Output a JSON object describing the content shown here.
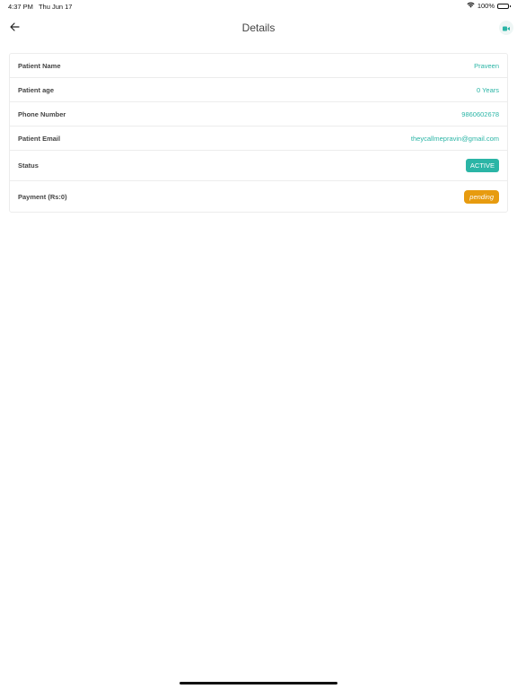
{
  "status_bar": {
    "time": "4:37 PM",
    "date": "Thu Jun 17",
    "battery": "100%",
    "battery_level": 1.0
  },
  "header": {
    "title": "Details",
    "back_icon": "arrow-left-icon",
    "video_icon": "video-camera-icon"
  },
  "details": {
    "patient_name": {
      "label": "Patient Name",
      "value": "Praveen"
    },
    "patient_age": {
      "label": "Patient age",
      "value": "0 Years"
    },
    "phone": {
      "label": "Phone Number",
      "value": "9860602678"
    },
    "email": {
      "label": "Patient Email",
      "value": "theycallmepravin@gmail.com"
    },
    "status": {
      "label": "Status",
      "value": "ACTIVE"
    },
    "payment": {
      "label": "Payment (Rs:0)",
      "value": "pending"
    }
  },
  "colors": {
    "accent": "#2bb5a6",
    "pending": "#e79b0f",
    "border": "#ececec"
  }
}
